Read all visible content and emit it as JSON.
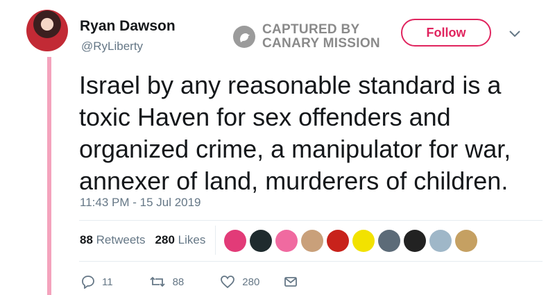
{
  "user": {
    "display_name": "Ryan Dawson",
    "handle": "@RyLiberty"
  },
  "watermark": {
    "line1": "CAPTURED BY",
    "line2": "CANARY MISSION"
  },
  "follow_label": "Follow",
  "tweet": {
    "lines": [
      "Israel by any reasonable standard is a",
      "toxic Haven for sex offenders and",
      "organized crime, a manipulator for war,",
      "annexer of land, murderers of children."
    ],
    "timestamp": "11:43 PM - 15 Jul 2019"
  },
  "stats": {
    "retweets_count": "88",
    "retweets_label": "Retweets",
    "likes_count": "280",
    "likes_label": "Likes"
  },
  "liker_avatars": [
    {
      "color": "#e23b78"
    },
    {
      "color": "#1f2b2e"
    },
    {
      "color": "#f06aa0"
    },
    {
      "color": "#c9a07a"
    },
    {
      "color": "#c8221b"
    },
    {
      "color": "#f2e200"
    },
    {
      "color": "#5c6b78"
    },
    {
      "color": "#222222"
    },
    {
      "color": "#9fb7c8"
    },
    {
      "color": "#c5a062"
    }
  ],
  "actions": {
    "reply_count": "11",
    "retweet_count": "88",
    "like_count": "280"
  },
  "colors": {
    "accent": "#e0245e",
    "thread_line": "#f4a3bd",
    "muted_text": "#657786"
  }
}
